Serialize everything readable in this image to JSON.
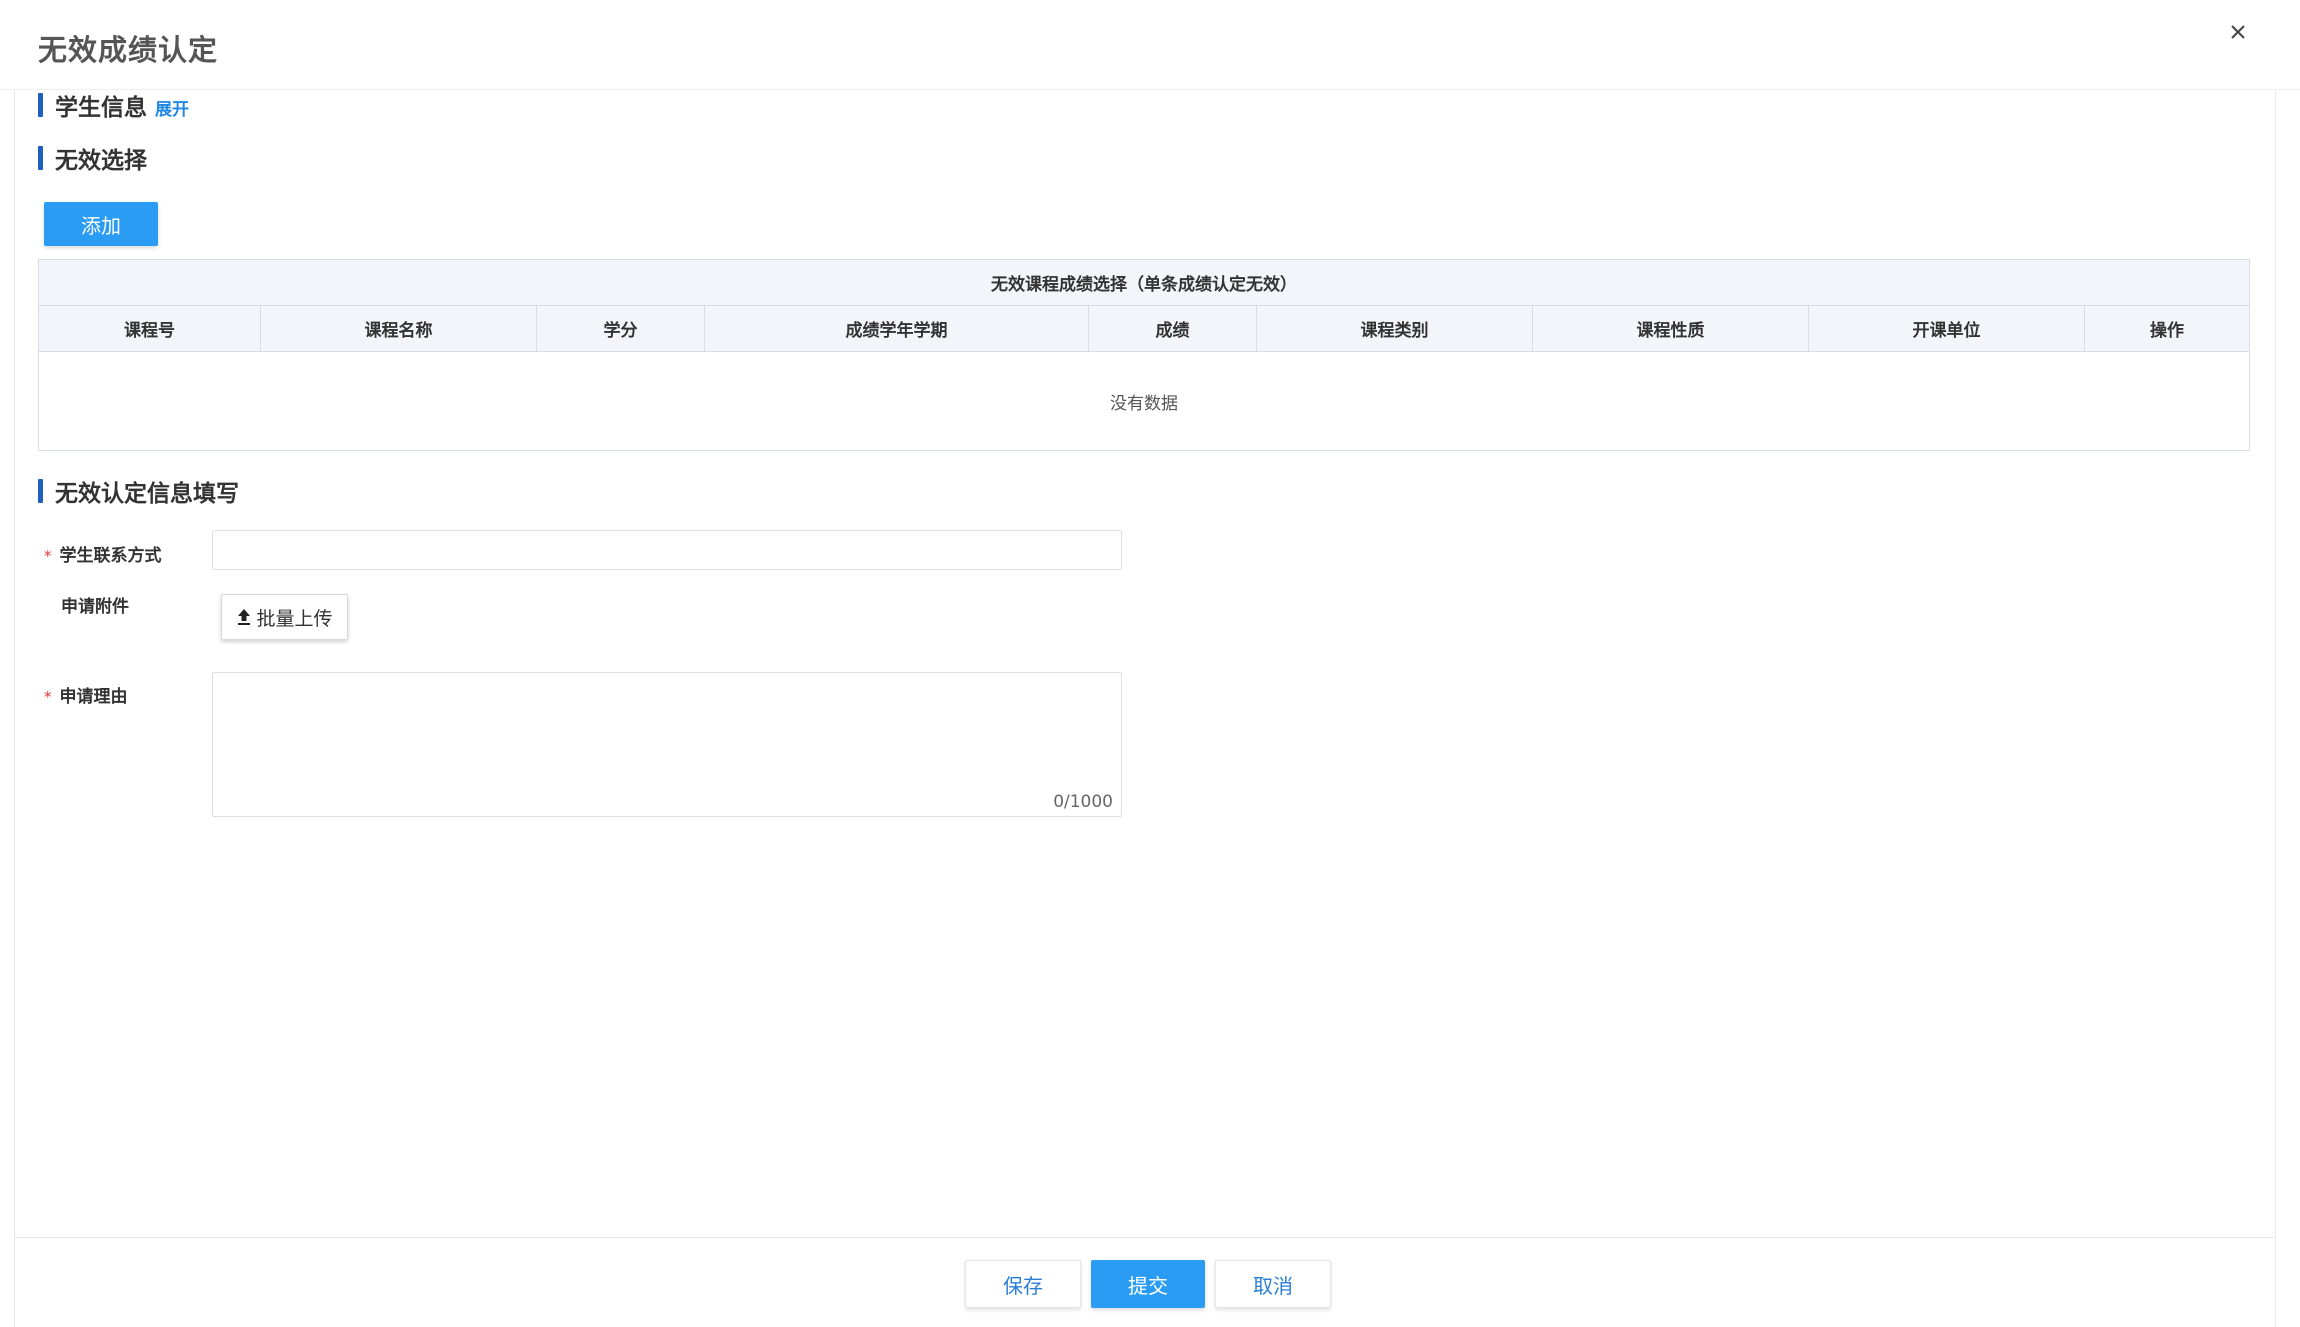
{
  "dialog": {
    "title": "无效成绩认定",
    "close_icon": "close-icon"
  },
  "sections": {
    "student_info": {
      "title": "学生信息",
      "expand_label": "展开"
    },
    "invalid_select": {
      "title": "无效选择"
    },
    "fill_info": {
      "title": "无效认定信息填写"
    }
  },
  "toolbar": {
    "add_label": "添加"
  },
  "grid": {
    "caption": "无效课程成绩选择（单条成绩认定无效）",
    "columns": [
      "课程号",
      "课程名称",
      "学分",
      "成绩学年学期",
      "成绩",
      "课程类别",
      "课程性质",
      "开课单位",
      "操作"
    ],
    "empty_text": "没有数据"
  },
  "form": {
    "contact_label": "学生联系方式",
    "contact_value": "",
    "attachment_label": "申请附件",
    "upload_label": "批量上传",
    "upload_icon": "upload-icon",
    "reason_label": "申请理由",
    "reason_value": "",
    "reason_count": "0/1000",
    "required_mark": "*"
  },
  "footer": {
    "save_label": "保存",
    "submit_label": "提交",
    "cancel_label": "取消"
  },
  "colors": {
    "primary": "#2a9cf4",
    "section_bar": "#1f5fbf",
    "link": "#1e88e5",
    "required": "#e53935"
  }
}
